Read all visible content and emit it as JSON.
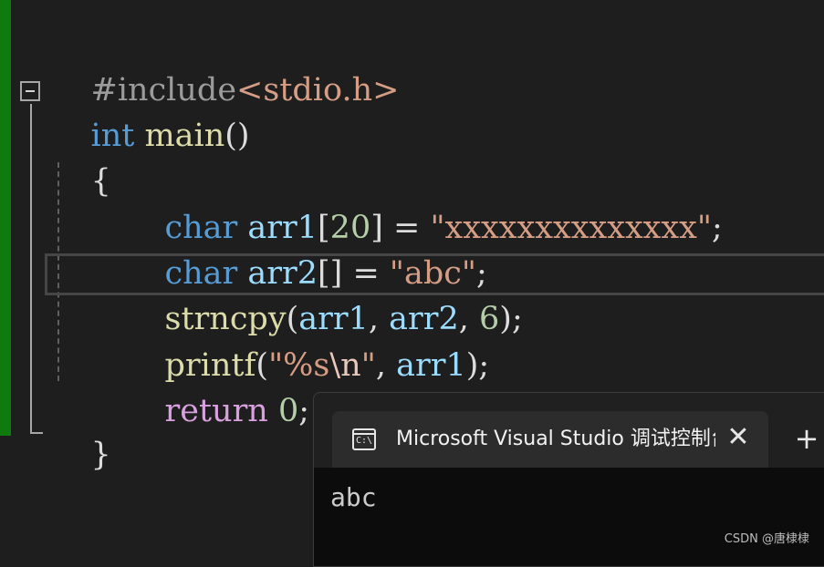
{
  "editor": {
    "lines": {
      "l1": {
        "directive": "#include",
        "header": "<stdio.h>"
      },
      "l2": {
        "type": "int",
        "func": "main",
        "parens": "()"
      },
      "l3": {
        "brace": "{"
      },
      "l4": {
        "type": "char",
        "var": "arr1",
        "open": "[",
        "size": "20",
        "close": "]",
        "eq": " = ",
        "string": "\"xxxxxxxxxxxxxx\"",
        "semi": ";"
      },
      "l5": {
        "type": "char",
        "var": "arr2",
        "brackets": "[]",
        "eq": " = ",
        "string": "\"abc\"",
        "semi": ";"
      },
      "l6": {
        "func": "strncpy",
        "open": "(",
        "arg1": "arr1",
        "comma1": ", ",
        "arg2": "arr2",
        "comma2": ", ",
        "num": "6",
        "close": ")",
        "semi": ";"
      },
      "l7": {
        "func": "printf",
        "open": "(",
        "str_a": "\"%s",
        "escape": "\\n",
        "str_b": "\"",
        "comma": ", ",
        "arg": "arr1",
        "close": ")",
        "semi": ";"
      },
      "l8": {
        "keyword": "return",
        "num": "0",
        "semi": ";"
      },
      "l9": {
        "brace": "}"
      }
    }
  },
  "console": {
    "tab_icon_text": "C:\\",
    "tab_title": "Microsoft Visual Studio 调试控制台",
    "close_glyph": "✕",
    "new_tab_glyph": "+",
    "output": "abc"
  },
  "watermark": "CSDN @唐棣棣",
  "colors": {
    "keyword": "#569cd6",
    "control_keyword": "#d8a0df",
    "function": "#dcdcaa",
    "variable": "#9cdcfe",
    "string": "#d69d85",
    "number": "#b5cea8",
    "gutter_bar": "#0f7b0f",
    "background": "#1e1e1e"
  }
}
